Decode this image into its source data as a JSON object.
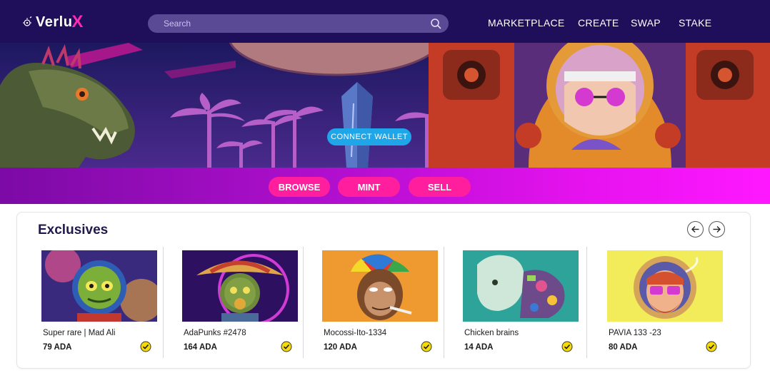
{
  "nav": {
    "logo_text": "Verlu",
    "logo_accent": "X",
    "search_placeholder": "Search",
    "links": [
      "MARKETPLACE",
      "CREATE",
      "SWAP",
      "STAKE"
    ]
  },
  "hero": {
    "connect_wallet": "CONNECT WALLET"
  },
  "actions": {
    "browse": "BROWSE",
    "mint": "MINT",
    "sell": "SELL"
  },
  "exclusives": {
    "title": "Exclusives",
    "items": [
      {
        "name": "Super rare | Mad Ali",
        "price": "79 ADA",
        "art": "lizard-astronaut"
      },
      {
        "name": "AdaPunks #2478",
        "price": "164 ADA",
        "art": "sombrero-lizard"
      },
      {
        "name": "Mocossi-Ito-1334",
        "price": "120 ADA",
        "art": "ape-cap"
      },
      {
        "name": "Chicken brains",
        "price": "14 ADA",
        "art": "cyber-head"
      },
      {
        "name": "PAVIA 133 -23",
        "price": "80 ADA",
        "art": "bearded-astronaut"
      }
    ]
  },
  "colors": {
    "nav_bg": "#1f0e5a",
    "accent_pink": "#ff1f9e",
    "connect_blue": "#1fa6e8",
    "verified_yellow": "#f5d90a"
  },
  "icons": [
    "search-icon",
    "arrow-left-icon",
    "arrow-right-icon",
    "verified-icon",
    "logo-mark-icon"
  ]
}
